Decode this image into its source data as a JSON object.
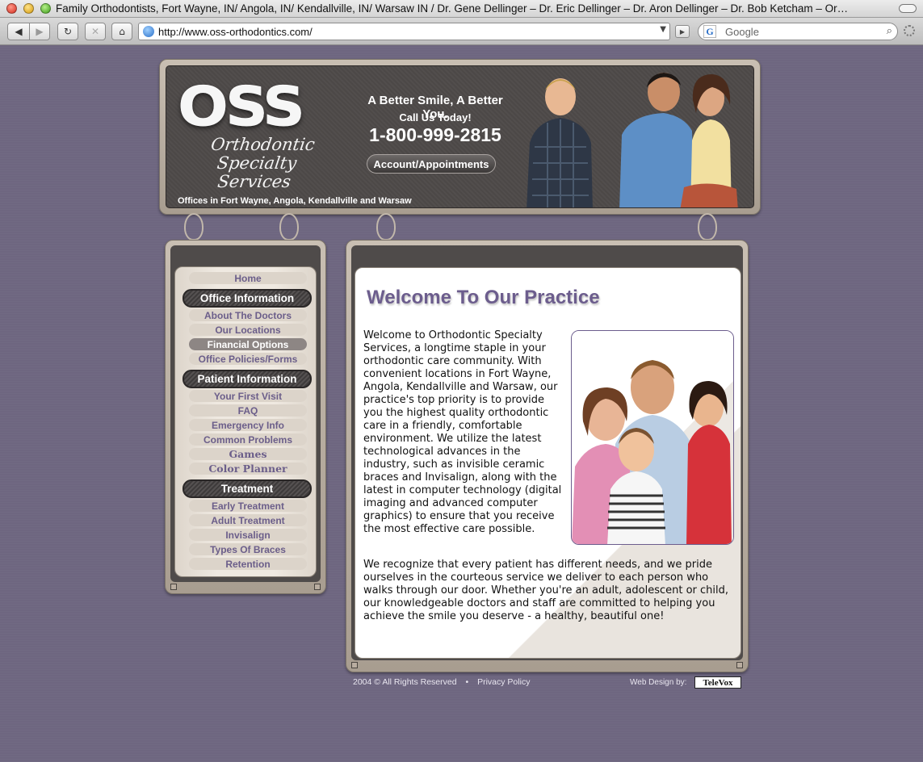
{
  "browser": {
    "window_title": "Family Orthodontists, Fort Wayne, IN/ Angola, IN/ Kendallville, IN/ Warsaw IN / Dr. Gene Dellinger – Dr. Eric Dellinger – Dr. Aron Dellinger – Dr. Bob Ketcham – Or…",
    "url": "http://www.oss-orthodontics.com/",
    "search_placeholder": "Google",
    "search_engine_letter": "G"
  },
  "header": {
    "logo_text": "OSS",
    "logo_script": [
      "Orthodontic",
      "Specialty",
      "Services"
    ],
    "tagline": "A Better Smile, A Better You.",
    "call_us": "Call Us Today!",
    "phone": "1-800-999-2815",
    "account_button": "Account/Appointments",
    "offices": "Offices in Fort Wayne, Angola, Kendallville and Warsaw"
  },
  "menu": {
    "home": "Home",
    "office_info": {
      "heading": "Office Information",
      "items": [
        "About The Doctors",
        "Our Locations",
        "Financial Options",
        "Office Policies/Forms"
      ]
    },
    "patient_info": {
      "heading": "Patient Information",
      "items": [
        "Your First Visit",
        "FAQ",
        "Emergency Info",
        "Common Problems",
        "Games",
        "Color Planner"
      ]
    },
    "treatment": {
      "heading": "Treatment",
      "items": [
        "Early Treatment",
        "Adult Treatment",
        "Invisalign",
        "Types Of Braces",
        "Retention"
      ]
    }
  },
  "main": {
    "title": "Welcome To Our Practice",
    "paragraph1": "Welcome to Orthodontic Specialty Services, a longtime staple in your orthodontic care community. With convenient locations in Fort Wayne, Angola, Kendallville and Warsaw, our practice's top priority is to provide you the highest quality orthodontic care in a friendly, comfortable environment. We utilize the latest technological advances in the industry, such as invisible ceramic braces and Invisalign, along with the latest in computer technology (digital imaging and advanced computer graphics) to ensure that you receive the most effective care possible.",
    "paragraph2": "We recognize that every patient has different needs, and we pride ourselves in the courteous service we deliver to each person who walks through our door. Whether you're an adult, adolescent or child, our knowledgeable doctors and staff are committed to helping you achieve the smile you deserve - a healthy, beautiful one!"
  },
  "footer": {
    "copyright": "2004 © All Rights Reserved",
    "bullet": "•",
    "privacy": "Privacy Policy",
    "web_design": "Web Design by:",
    "televox": "TeleVox"
  },
  "colors": {
    "background": "#6f677e",
    "accent_purple": "#6c5d8d",
    "frame": "#c9bfb3",
    "panel_dark": "#4f4b4a"
  }
}
